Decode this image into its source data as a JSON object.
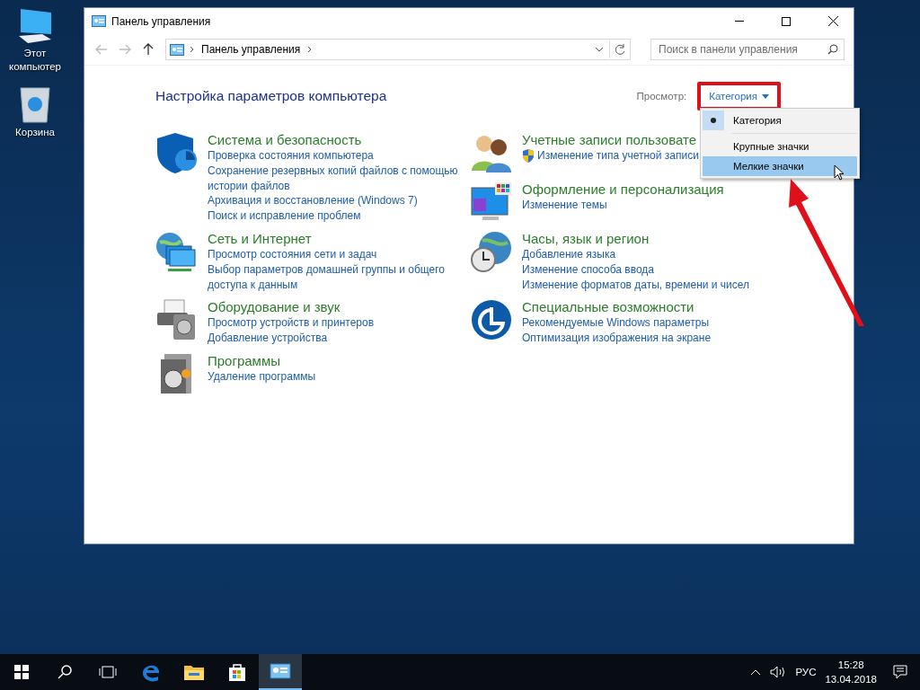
{
  "desktop_icons": [
    {
      "kind": "computer",
      "label": "Этот компьютер"
    },
    {
      "kind": "bin",
      "label": "Корзина"
    }
  ],
  "window": {
    "title": "Панель управления"
  },
  "address_bar": {
    "breadcrumb": "Панель управления"
  },
  "search": {
    "placeholder": "Поиск в панели управления"
  },
  "heading": "Настройка параметров компьютера",
  "view": {
    "label": "Просмотр:",
    "value": "Категория"
  },
  "view_menu": [
    {
      "label": "Категория",
      "selected": true,
      "hovered": false
    },
    {
      "label": "Крупные значки",
      "selected": false,
      "hovered": false
    },
    {
      "label": "Мелкие значки",
      "selected": false,
      "hovered": true
    }
  ],
  "columns": [
    [
      {
        "kind": "security",
        "title": "Система и безопасность",
        "links": [
          {
            "text": "Проверка состояния компьютера",
            "kind": "plain"
          },
          {
            "text": "Сохранение резервных копий файлов с помощью истории файлов",
            "kind": "plain"
          },
          {
            "text": "Архивация и восстановление (Windows 7)",
            "kind": "plain"
          },
          {
            "text": "Поиск и исправление проблем",
            "kind": "plain"
          }
        ]
      },
      {
        "kind": "network",
        "title": "Сеть и Интернет",
        "links": [
          {
            "text": "Просмотр состояния сети и задач",
            "kind": "plain"
          },
          {
            "text": "Выбор параметров домашней группы и общего доступа к данным",
            "kind": "plain"
          }
        ]
      },
      {
        "kind": "hardware",
        "title": "Оборудование и звук",
        "links": [
          {
            "text": "Просмотр устройств и принтеров",
            "kind": "plain"
          },
          {
            "text": "Добавление устройства",
            "kind": "plain"
          }
        ]
      },
      {
        "kind": "programs",
        "title": "Программы",
        "links": [
          {
            "text": "Удаление программы",
            "kind": "plain"
          }
        ]
      }
    ],
    [
      {
        "kind": "users",
        "title": "Учетные записи пользовате",
        "links": [
          {
            "text": "Изменение типа учетной записи",
            "kind": "shield"
          }
        ]
      },
      {
        "kind": "appearance",
        "title": "Оформление и персонализация",
        "links": [
          {
            "text": "Изменение темы",
            "kind": "plain"
          }
        ]
      },
      {
        "kind": "clock",
        "title": "Часы, язык и регион",
        "links": [
          {
            "text": "Добавление языка",
            "kind": "plain"
          },
          {
            "text": "Изменение способа ввода",
            "kind": "plain"
          },
          {
            "text": "Изменение форматов даты, времени и чисел",
            "kind": "plain"
          }
        ]
      },
      {
        "kind": "access",
        "title": "Специальные возможности",
        "links": [
          {
            "text": "Рекомендуемые Windows параметры",
            "kind": "plain"
          },
          {
            "text": "Оптимизация изображения на экране",
            "kind": "plain"
          }
        ]
      }
    ]
  ],
  "taskbar": {
    "apps": [
      {
        "kind": "edge",
        "active": false
      },
      {
        "kind": "explorer",
        "active": false
      },
      {
        "kind": "store",
        "active": false
      },
      {
        "kind": "control",
        "active": true
      }
    ],
    "language": "РУС",
    "time": "15:28",
    "date": "13.04.2018"
  }
}
